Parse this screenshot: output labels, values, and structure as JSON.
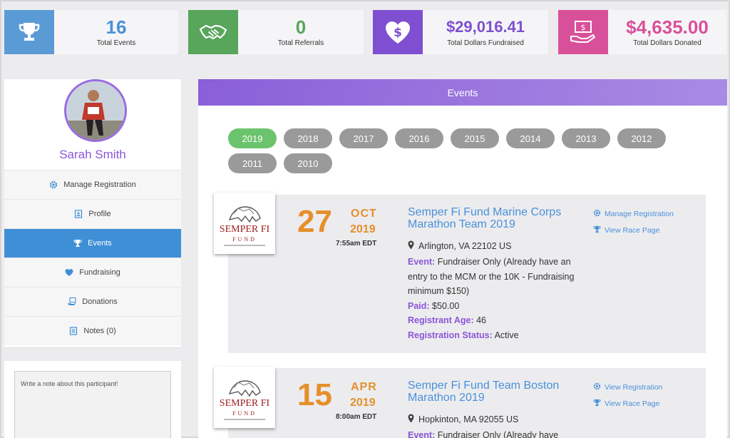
{
  "stats": [
    {
      "value": "16",
      "label": "Total Events",
      "icon": "trophy-icon",
      "color": "#5b9bd5",
      "value_color": "#4a90d9"
    },
    {
      "value": "0",
      "label": "Total Referrals",
      "icon": "handshake-icon",
      "color": "#58a55c",
      "value_color": "#58a55c"
    },
    {
      "value": "$29,016.41",
      "label": "Total Dollars Fundraised",
      "icon": "heart-dollar-icon",
      "color": "#7e4fd0",
      "value_color": "#7e4fd0"
    },
    {
      "value": "$4,635.00",
      "label": "Total Dollars Donated",
      "icon": "hand-money-icon",
      "color": "#d9509a",
      "value_color": "#d9509a"
    }
  ],
  "profile": {
    "name": "Sarah Smith",
    "menu": [
      {
        "label": "Manage Registration",
        "icon": "gear-icon",
        "active": false
      },
      {
        "label": "Profile",
        "icon": "profile-card-icon",
        "active": false
      },
      {
        "label": "Events",
        "icon": "trophy-icon",
        "active": true
      },
      {
        "label": "Fundraising",
        "icon": "heart-icon",
        "active": false
      },
      {
        "label": "Donations",
        "icon": "donation-icon",
        "active": false
      },
      {
        "label": "Notes (0)",
        "icon": "notes-icon",
        "active": false
      }
    ]
  },
  "notes": {
    "placeholder": "Write a note about this participant!"
  },
  "events_panel": {
    "title": "Events",
    "years": [
      "2019",
      "2018",
      "2017",
      "2016",
      "2015",
      "2014",
      "2013",
      "2012",
      "2011",
      "2010"
    ],
    "active_year": "2019",
    "events": [
      {
        "logo_line1": "SEMPER FI",
        "logo_line2": "FUND",
        "day": "27",
        "month": "OCT",
        "year": "2019",
        "time": "7:55am EDT",
        "title": "Semper Fi Fund Marine Corps Marathon Team 2019",
        "location": "Arlington, VA 22102 US",
        "event_label": "Event:",
        "event_value": "Fundraiser Only (Already have an entry to the MCM or the 10K - Fundraising minimum $150)",
        "paid_label": "Paid:",
        "paid_value": "$50.00",
        "age_label": "Registrant Age:",
        "age_value": "46",
        "status_label": "Registration Status:",
        "status_value": "Active",
        "link1": "Manage Registration",
        "link2": "View Race Page"
      },
      {
        "logo_line1": "SEMPER FI",
        "logo_line2": "FUND",
        "day": "15",
        "month": "APR",
        "year": "2019",
        "time": "8:00am EDT",
        "title": "Semper Fi Fund Team Boston Marathon 2019",
        "location": "Hopkinton, MA 92055 US",
        "event_label": "Event:",
        "event_value": "Fundraiser Only (Already have",
        "link1": "View Registration",
        "link2": "View Race Page"
      }
    ]
  }
}
